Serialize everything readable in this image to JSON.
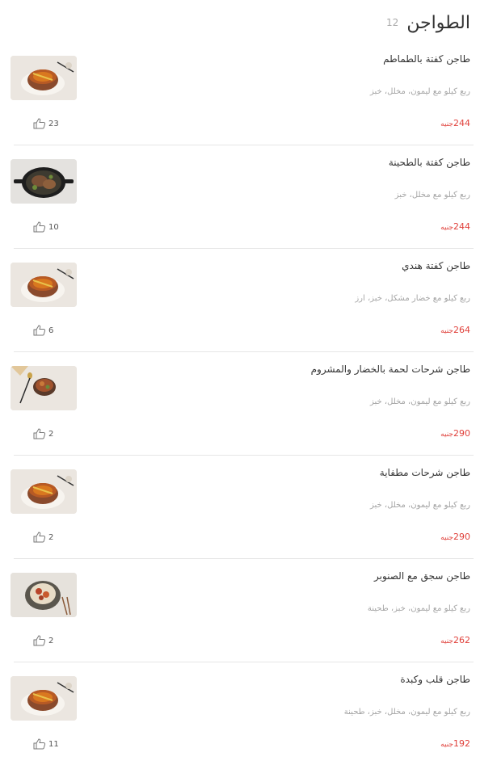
{
  "header": {
    "title": "الطواجن",
    "count": "12"
  },
  "currency": "جنيه",
  "items": [
    {
      "name": "طاجن كفتة بالطماطم",
      "desc": "ربع كيلو مع ليمون، مخلل، خبز",
      "price": "244",
      "likes": "23",
      "thumb": "pot-icon"
    },
    {
      "name": "طاجن كفتة بالطحينة",
      "desc": "ربع كيلو مع مخلل، خبز",
      "price": "244",
      "likes": "10",
      "thumb": "pan-icon"
    },
    {
      "name": "طاجن كفتة هندي",
      "desc": "ربع كيلو مع خضار مشكل، خبز، ارز",
      "price": "264",
      "likes": "6",
      "thumb": "pot-icon"
    },
    {
      "name": "طاجن شرحات لحمة بالخضار والمشروم",
      "desc": "ربع كيلو مع ليمون، مخلل، خبز",
      "price": "290",
      "likes": "2",
      "thumb": "pot-spoon-icon"
    },
    {
      "name": "طاجن شرحات مطفاية",
      "desc": "ربع كيلو مع ليمون، مخلل، خبز",
      "price": "290",
      "likes": "2",
      "thumb": "pot-icon"
    },
    {
      "name": "طاجن سجق مع الصنوبر",
      "desc": "ربع كيلو مع ليمون، خبز، طحينة",
      "price": "262",
      "likes": "2",
      "thumb": "bowl-icon"
    },
    {
      "name": "طاجن قلب وكبدة",
      "desc": "ربع كيلو مع ليمون، مخلل، خبز، طحينة",
      "price": "192",
      "likes": "11",
      "thumb": "pot-icon"
    }
  ]
}
